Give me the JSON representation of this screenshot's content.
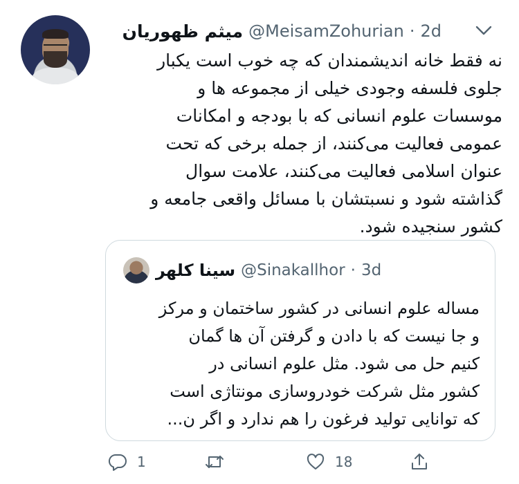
{
  "tweet": {
    "author_name": "میثم ظهوریان",
    "handle": "@MeisamZohurian",
    "separator": "·",
    "time": "2d",
    "text_lines": [
      "نه فقط خانه اندیشمندان که چه خوب است یکبار",
      "جلوی فلسفه وجودی خیلی از مجموعه ها و",
      "موسسات علوم انسانی که با بودجه و امکانات",
      "عمومی فعالیت می‌کنند، از جمله برخی که تحت",
      "عنوان اسلامی فعالیت می‌کنند، علامت سوال",
      "گذاشته شود و نسبتشان با مسائل واقعی جامعه و",
      "کشور سنجیده شود."
    ]
  },
  "quote": {
    "author_name": "سینا کلهر",
    "handle": "@Sinakallhor",
    "separator": "·",
    "time": "3d",
    "text_lines": [
      "مساله علوم انسانی در کشور ساختمان و مرکز",
      "و جا نیست که با دادن و گرفتن آن ها گمان",
      "کنیم حل می شود. مثل علوم انسانی در",
      "کشور مثل شرکت خودروسازی مونتاژی است",
      "که توانایی تولید فرغون را هم ندارد و اگر ن..."
    ]
  },
  "actions": {
    "reply_count": "1",
    "retweet_count": "",
    "like_count": "18"
  },
  "icons": [
    "chevron-down-icon",
    "reply-icon",
    "retweet-icon",
    "like-icon",
    "share-icon"
  ],
  "colors": {
    "text": "#0f1419",
    "secondary": "#536471",
    "border": "#cfd9de"
  }
}
